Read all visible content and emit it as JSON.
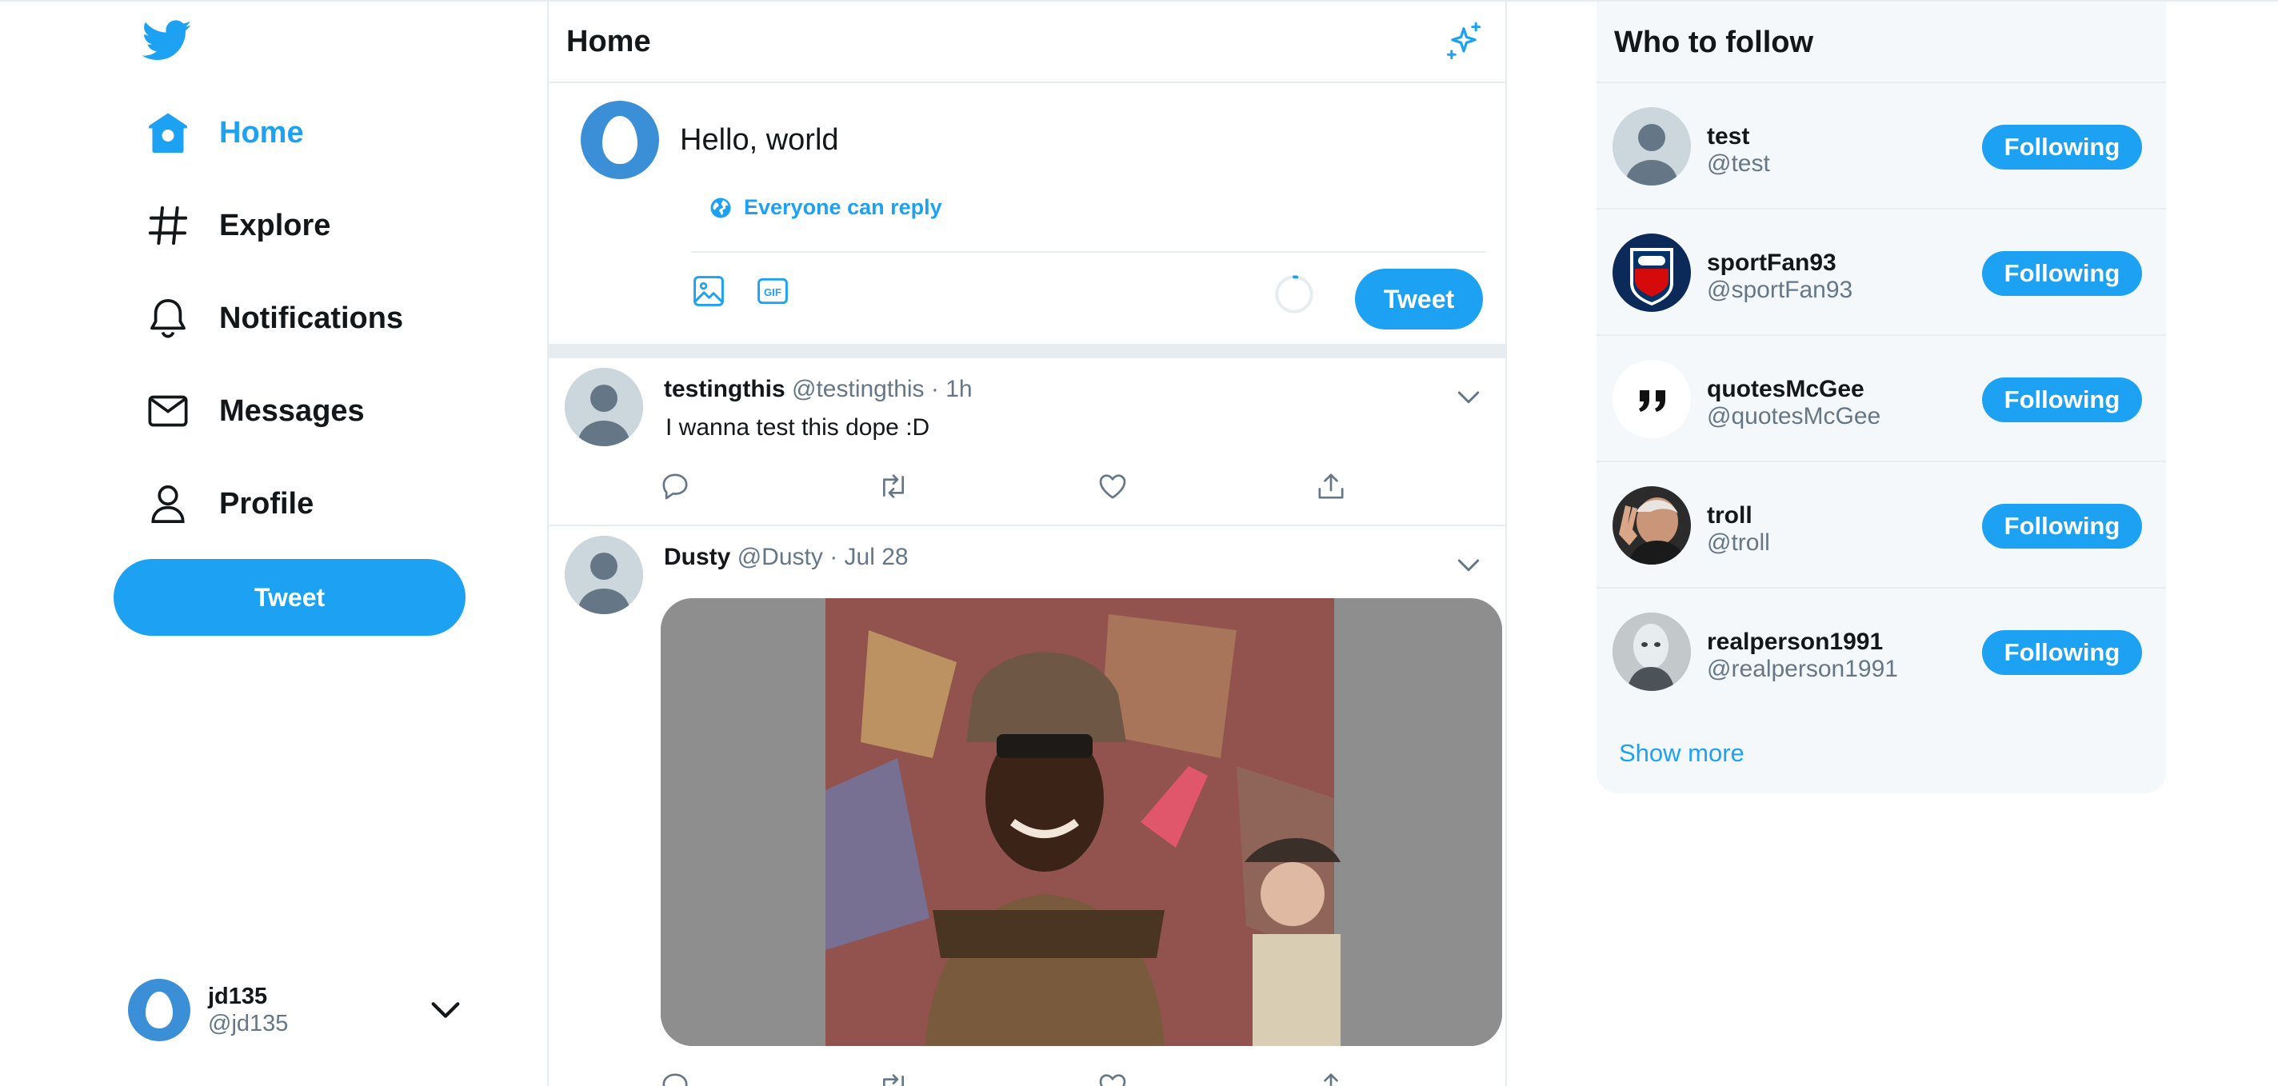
{
  "nav": {
    "items": [
      {
        "label": "Home",
        "icon": "home-icon",
        "active": true
      },
      {
        "label": "Explore",
        "icon": "hashtag-icon"
      },
      {
        "label": "Notifications",
        "icon": "bell-icon"
      },
      {
        "label": "Messages",
        "icon": "mail-icon"
      },
      {
        "label": "Profile",
        "icon": "person-icon"
      }
    ],
    "tweet_button": "Tweet"
  },
  "account": {
    "name": "jd135",
    "handle": "@jd135"
  },
  "timeline": {
    "title": "Home",
    "composer": {
      "text": "Hello, world",
      "reply_setting": "Everyone can reply",
      "tweet_button": "Tweet"
    },
    "tweets": [
      {
        "name": "testingthis",
        "handle": "@testingthis",
        "time": "· 1h",
        "text": "I wanna test this dope :D"
      },
      {
        "name": "Dusty",
        "handle": "@Dusty",
        "time": "· Jul 28",
        "text": ""
      }
    ]
  },
  "who_to_follow": {
    "title": "Who to follow",
    "accounts": [
      {
        "name": "test",
        "handle": "@test",
        "button": "Following"
      },
      {
        "name": "sportFan93",
        "handle": "@sportFan93",
        "button": "Following"
      },
      {
        "name": "quotesMcGee",
        "handle": "@quotesMcGee",
        "button": "Following"
      },
      {
        "name": "troll",
        "handle": "@troll",
        "button": "Following"
      },
      {
        "name": "realperson1991",
        "handle": "@realperson1991",
        "button": "Following"
      }
    ],
    "show_more": "Show more"
  },
  "colors": {
    "accent": "#1da1f2",
    "text": "#14171a",
    "muted": "#657786",
    "border": "#e6ecf0",
    "panel": "#f5f8fa"
  }
}
